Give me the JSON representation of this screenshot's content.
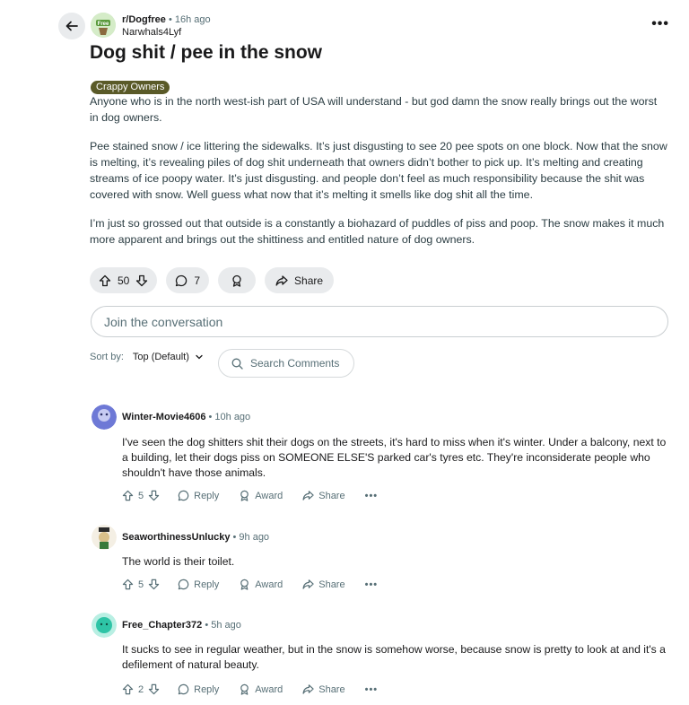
{
  "post": {
    "subreddit": "r/Dogfree",
    "time": "• 16h ago",
    "author": "Narwhals4Lyf",
    "subreddit_icon_text": "Free",
    "title": "Dog shit / pee in the snow",
    "flair": "Crappy Owners",
    "paragraphs": [
      "Anyone who is in the north west-ish part of USA will understand - but god damn the snow really brings out the worst in dog owners.",
      "Pee stained snow / ice littering the sidewalks. It’s just disgusting to see 20 pee spots on one block. Now that the snow is melting, it’s revealing piles of dog shit underneath that owners didn’t bother to pick up. It’s melting and creating streams of ice poopy water. It’s just disgusting. and people don’t feel as much responsibility because the shit was covered with snow. Well guess what now that it’s melting it smells like dog shit all the time.",
      "I’m just so grossed out that outside is a constantly a biohazard of puddles of piss and poop. The snow makes it much more apparent and brings out the shittiness and entitled nature of dog owners."
    ],
    "votes": "50",
    "comments": "7",
    "share_label": "Share",
    "more_label": "•••"
  },
  "join": {
    "placeholder": "Join the conversation"
  },
  "sort": {
    "label": "Sort by:",
    "value": "Top (Default)"
  },
  "search": {
    "placeholder": "Search Comments"
  },
  "comments": [
    {
      "user": "Winter-Movie4606",
      "time": "• 10h ago",
      "text": "I've seen the dog shitters shit their dogs on the streets, it's hard to miss when it's winter. Under a balcony, next to a building, let their dogs piss on SOMEONE ELSE'S parked car's tyres etc. They're inconsiderate people who shouldn't have those animals.",
      "votes": "5",
      "reply": "Reply",
      "award": "Award",
      "share": "Share",
      "more": "•••",
      "avatar_color": "#6e79d6"
    },
    {
      "user": "SeaworthinessUnlucky",
      "time": "• 9h ago",
      "text": "The world is their toilet.",
      "votes": "5",
      "reply": "Reply",
      "award": "Award",
      "share": "Share",
      "more": "•••",
      "avatar_color": "#d9c08a"
    },
    {
      "user": "Free_Chapter372",
      "time": "• 5h ago",
      "text": "It sucks to see in regular weather, but in the snow is somehow worse, because snow is pretty to look at and it's a defilement of natural beauty.",
      "votes": "2",
      "reply": "Reply",
      "award": "Award",
      "share": "Share",
      "more": "•••",
      "avatar_color": "#2ec4a6"
    }
  ]
}
